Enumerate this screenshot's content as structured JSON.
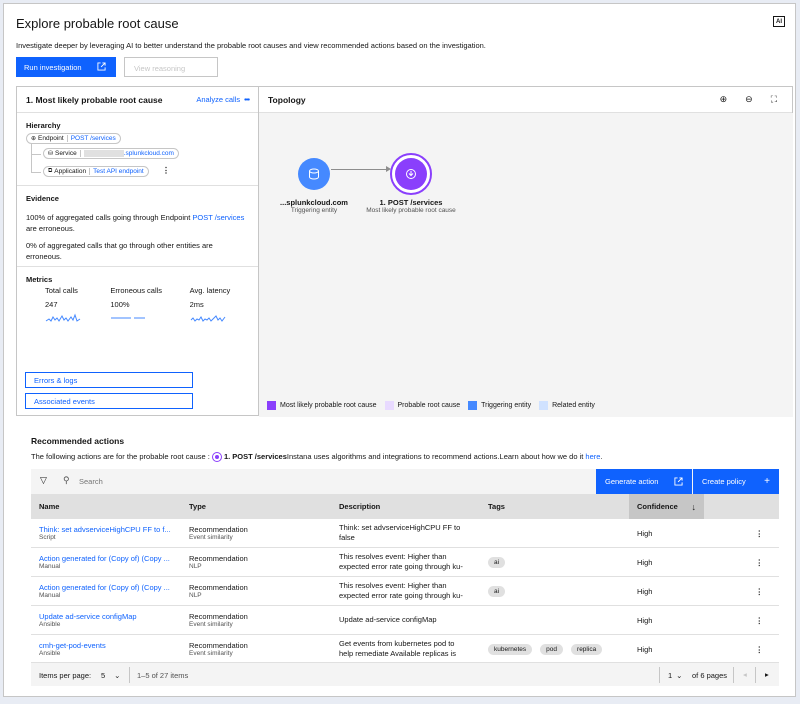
{
  "header": {
    "title": "Explore probable root cause",
    "ai_badge": "AI",
    "subtitle": "Investigate deeper by leveraging AI to better understand the probable root causes and view recommended actions based on the investigation.",
    "run_button": "Run investigation",
    "view_reasoning": "View reasoning"
  },
  "left_panel": {
    "title": "1. Most likely probable root cause",
    "analyze_calls": "Analyze calls",
    "hierarchy": {
      "title": "Hierarchy",
      "endpoint_label": "Endpoint",
      "endpoint_value": "POST /services",
      "service_label": "Service",
      "service_value": ".splunkcloud.com",
      "application_label": "Application",
      "application_value": "Test API endpoint"
    },
    "evidence": {
      "title": "Evidence",
      "line1_pre": "100% of aggregated calls going through Endpoint ",
      "line1_link": "POST /services",
      "line1_post": " are erroneous.",
      "line2": "0% of aggregated calls that go through other entities are erroneous."
    },
    "metrics": {
      "title": "Metrics",
      "items": [
        {
          "label": "Total calls",
          "value": "247"
        },
        {
          "label": "Erroneous calls",
          "value": "100%"
        },
        {
          "label": "Avg. latency",
          "value": "2ms"
        }
      ]
    },
    "errors_logs": "Errors & logs",
    "associated_events": "Associated events"
  },
  "topology": {
    "title": "Topology",
    "nodes": [
      {
        "name": "...splunkcloud.com",
        "sub": "Triggering entity"
      },
      {
        "name": "1. POST /services",
        "sub": "Most likely probable root cause"
      }
    ],
    "legend": [
      {
        "label": "Most likely probable root cause",
        "color": "#8a3ffc"
      },
      {
        "label": "Probable root cause",
        "color": "#e8daff"
      },
      {
        "label": "Triggering entity",
        "color": "#4589ff"
      },
      {
        "label": "Related entity",
        "color": "#d0e2ff"
      }
    ]
  },
  "recommended": {
    "title": "Recommended actions",
    "sub_pre": "The following actions are for the probable root cause : ",
    "sub_entity": "1. POST /services",
    "sub_post": "Instana uses algorithms and integrations to recommend actions.Learn about how we do it ",
    "sub_link": "here",
    "sub_end": ".",
    "search_placeholder": "Search",
    "generate_action": "Generate action",
    "create_policy": "Create policy",
    "columns": [
      "Name",
      "Type",
      "Description",
      "Tags",
      "Confidence"
    ],
    "rows": [
      {
        "name": "Think: set advserviceHighCPU FF to f...",
        "sub": "Script",
        "type": "Recommendation",
        "type_sub": "Event similarity",
        "desc": "Think: set advserviceHighCPU FF to false",
        "tags": [],
        "confidence": "High"
      },
      {
        "name": "Action generated for (Copy of) (Copy ...",
        "sub": "Manual",
        "type": "Recommendation",
        "type_sub": "NLP",
        "desc": "This resolves event: Higher than expected error rate going through ku-",
        "tags": [
          "ai"
        ],
        "confidence": "High"
      },
      {
        "name": "Action generated for (Copy of) (Copy ...",
        "sub": "Manual",
        "type": "Recommendation",
        "type_sub": "NLP",
        "desc": "This resolves event: Higher than expected error rate going through ku-",
        "tags": [
          "ai"
        ],
        "confidence": "High"
      },
      {
        "name": "Update ad-service configMap",
        "sub": "Ansible",
        "type": "Recommendation",
        "type_sub": "Event similarity",
        "desc": "Update ad-service configMap",
        "tags": [],
        "confidence": "High"
      },
      {
        "name": "cmh-get-pod-events",
        "sub": "Ansible",
        "type": "Recommendation",
        "type_sub": "Event similarity",
        "desc": "Get events from kubernetes pod to help remediate Available replicas is",
        "tags": [
          "kubernetes",
          "pod",
          "replica"
        ],
        "confidence": "High"
      }
    ],
    "pager": {
      "items_per_page_label": "Items per page:",
      "items_per_page": "5",
      "range": "1–5 of 27 items",
      "page": "1",
      "of_pages": "of 6 pages"
    }
  }
}
